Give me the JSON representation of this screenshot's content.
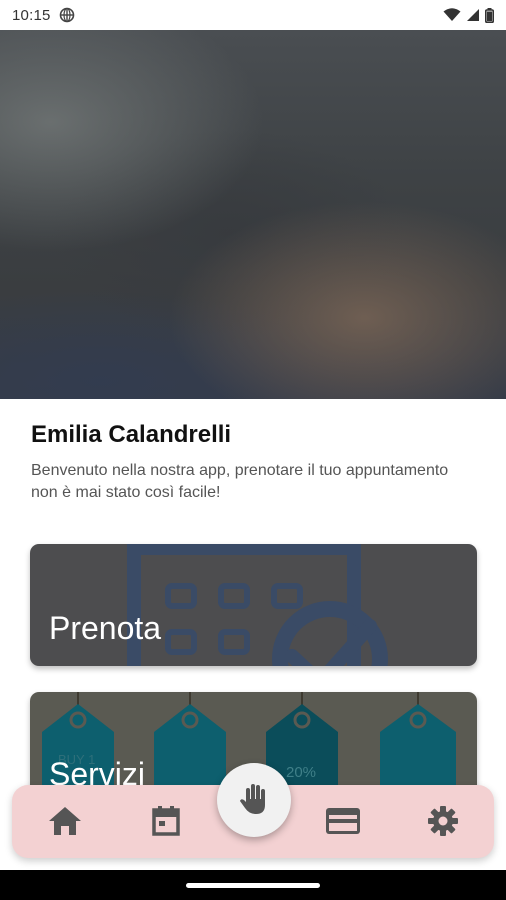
{
  "status_bar": {
    "time": "10:15",
    "icons": [
      "vpn-globe-icon",
      "wifi-icon",
      "signal-icon",
      "battery-icon"
    ]
  },
  "hero": {
    "image": "blurred-salon-photo"
  },
  "profile": {
    "name": "Emilia Calandrelli",
    "welcome": "Benvenuto nella nostra app, prenotare il tuo appuntamento non è mai stato così facile!"
  },
  "cards": {
    "prenota": {
      "label": "Prenota",
      "icon": "calendar-check-icon"
    },
    "servizi": {
      "label": "Servizi",
      "icon": "price-tags-image",
      "tag_texts": [
        "BUY 1",
        "20%"
      ]
    }
  },
  "bottom_nav": {
    "items": [
      {
        "name": "home",
        "icon": "home-icon"
      },
      {
        "name": "calendar",
        "icon": "calendar-icon"
      },
      {
        "name": "hand",
        "icon": "hand-icon"
      },
      {
        "name": "payment",
        "icon": "credit-card-icon"
      },
      {
        "name": "settings",
        "icon": "gear-icon"
      }
    ],
    "colors": {
      "background": "#f3d1d2",
      "icon": "#555555",
      "fab": "#f1f1f1"
    }
  }
}
